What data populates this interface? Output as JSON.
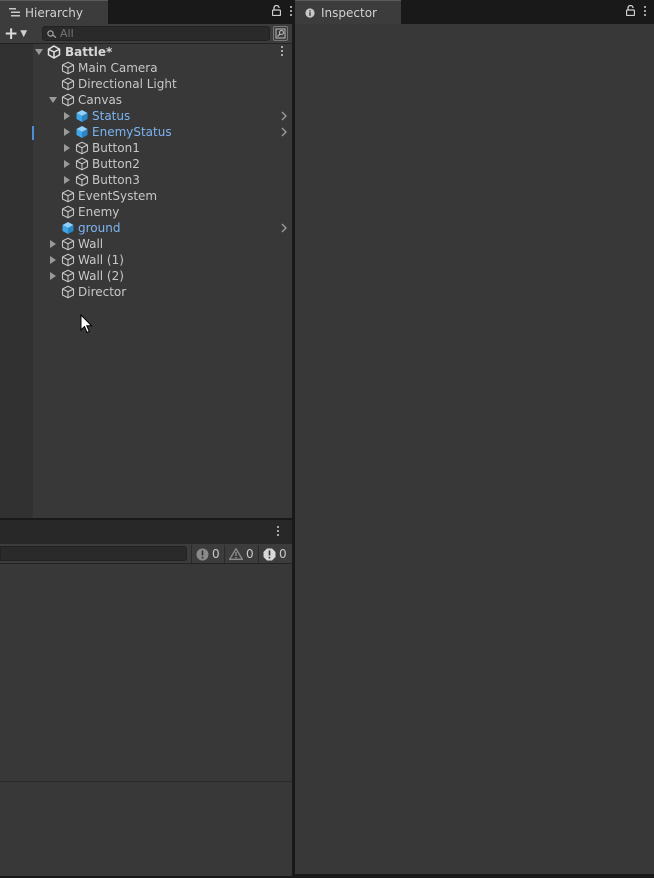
{
  "hierarchy": {
    "tab_label": "Hierarchy",
    "search_placeholder": "All",
    "scene": {
      "name": "Battle*"
    },
    "items": [
      {
        "label": "Main Camera",
        "depth": 1,
        "expander": "none",
        "prefab": false,
        "chevron": false
      },
      {
        "label": "Directional Light",
        "depth": 1,
        "expander": "none",
        "prefab": false,
        "chevron": false
      },
      {
        "label": "Canvas",
        "depth": 1,
        "expander": "expanded",
        "prefab": false,
        "chevron": false
      },
      {
        "label": "Status",
        "depth": 2,
        "expander": "collapsed",
        "prefab": true,
        "chevron": true
      },
      {
        "label": "EnemyStatus",
        "depth": 2,
        "expander": "collapsed",
        "prefab": true,
        "chevron": true
      },
      {
        "label": "Button1",
        "depth": 2,
        "expander": "collapsed",
        "prefab": false,
        "chevron": false
      },
      {
        "label": "Button2",
        "depth": 2,
        "expander": "collapsed",
        "prefab": false,
        "chevron": false
      },
      {
        "label": "Button3",
        "depth": 2,
        "expander": "collapsed",
        "prefab": false,
        "chevron": false
      },
      {
        "label": "EventSystem",
        "depth": 1,
        "expander": "none",
        "prefab": false,
        "chevron": false
      },
      {
        "label": "Enemy",
        "depth": 1,
        "expander": "none",
        "prefab": false,
        "chevron": false
      },
      {
        "label": "ground",
        "depth": 1,
        "expander": "none",
        "prefab": true,
        "chevron": true
      },
      {
        "label": "Wall",
        "depth": 1,
        "expander": "collapsed",
        "prefab": false,
        "chevron": false
      },
      {
        "label": "Wall (1)",
        "depth": 1,
        "expander": "collapsed",
        "prefab": false,
        "chevron": false
      },
      {
        "label": "Wall (2)",
        "depth": 1,
        "expander": "collapsed",
        "prefab": false,
        "chevron": false
      },
      {
        "label": "Director",
        "depth": 1,
        "expander": "none",
        "prefab": false,
        "chevron": false
      }
    ]
  },
  "console": {
    "log_count": "0",
    "warning_count": "0",
    "error_count": "0"
  },
  "inspector": {
    "tab_label": "Inspector"
  },
  "colors": {
    "prefab_text": "#7cb4f2",
    "prefab_icon": "#3fa7e8",
    "panel_bg": "#383838",
    "tab_bg": "#3c3c3c"
  }
}
